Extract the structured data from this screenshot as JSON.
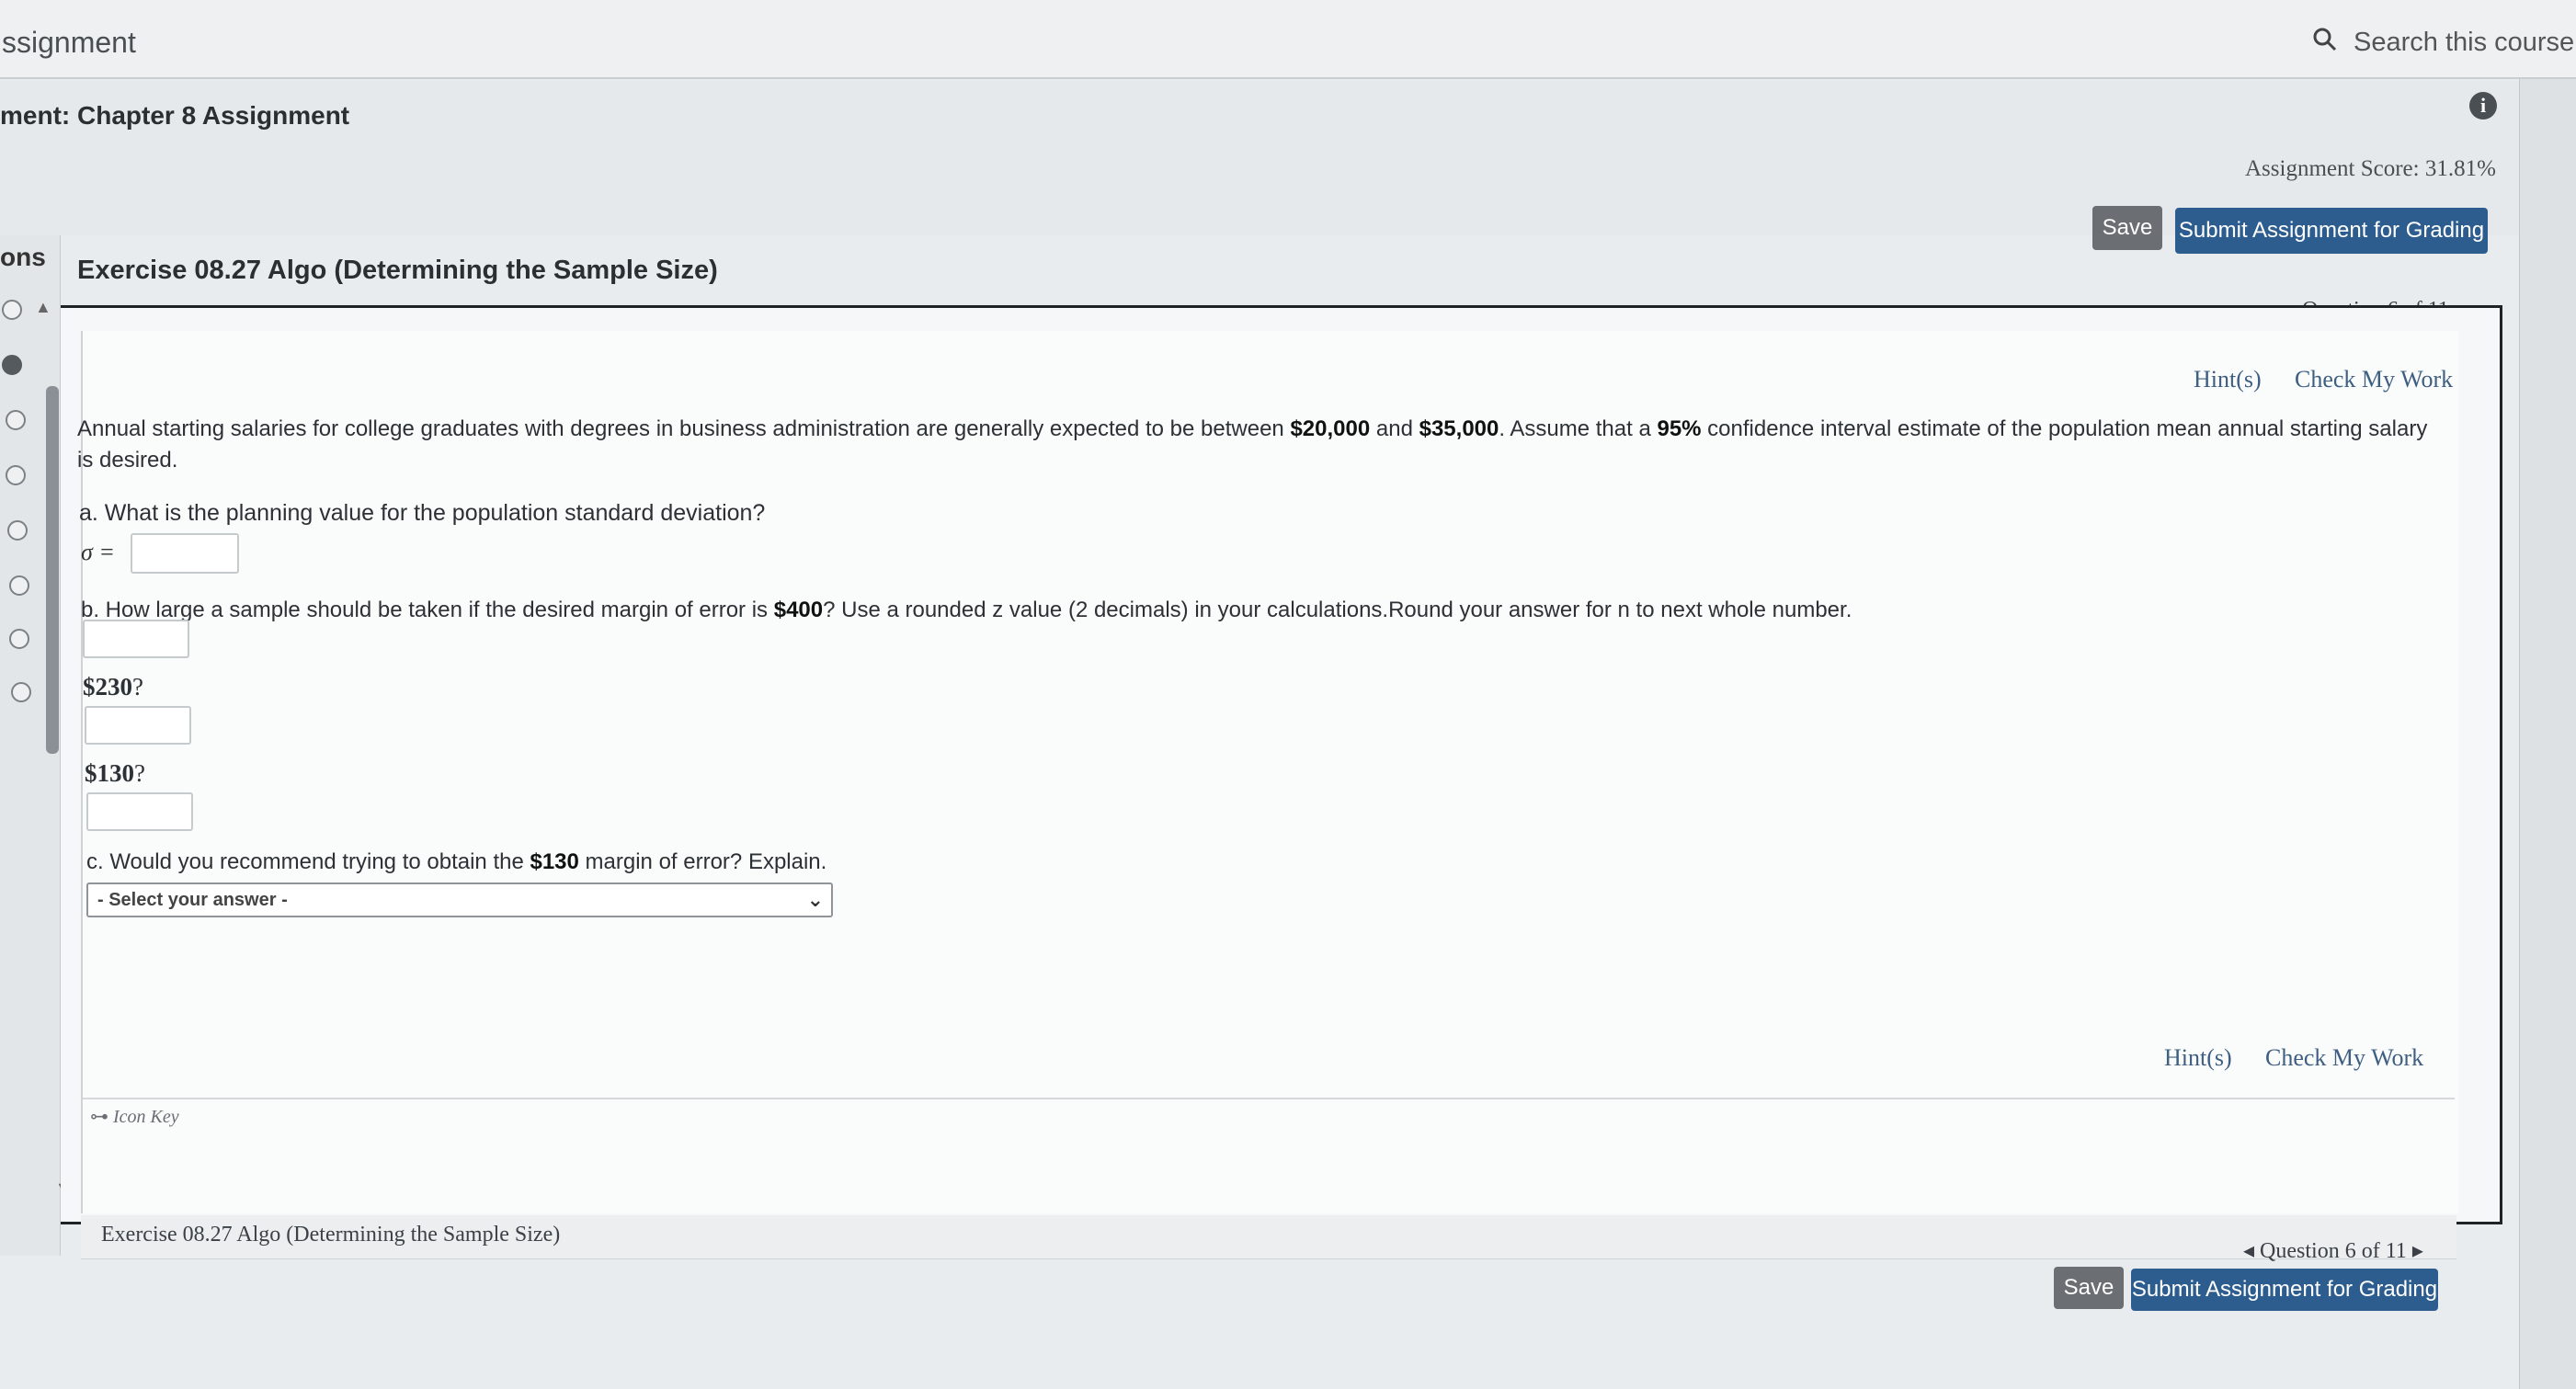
{
  "topbar": {
    "title": "ssignment",
    "search_placeholder": "Search this course"
  },
  "header": {
    "assignment_title": "ment: Chapter 8 Assignment",
    "score": "Assignment Score: 31.81%",
    "save_label": "Save",
    "submit_label": "Submit Assignment for Grading"
  },
  "left": {
    "label": "ons"
  },
  "exercise": {
    "title": "Exercise 08.27 Algo (Determining the Sample Size)",
    "question_nav": "Question 6 of 11",
    "hints": "Hint(s)",
    "check": "Check My Work",
    "intro_1": "Annual starting salaries for college graduates with degrees in business administration are generally expected to be between ",
    "amount_low": "$20,000",
    "and": " and ",
    "amount_high": "$35,000",
    "intro_2": ". Assume that a ",
    "confidence": "95%",
    "intro_3": " confidence interval estimate of the population mean annual starting salary is desired.",
    "qa": "a. What is the planning value for the population standard deviation?",
    "sigma_label": "σ =",
    "qb_1": "b. How large a sample should be taken if the desired margin of error is ",
    "qb_amount": "$400",
    "qb_2": "? Use a rounded z value (2 decimals) in your calculations.Round your answer for n to next whole number.",
    "label_230_amount": "$230",
    "label_230_q": "?",
    "label_130_amount": "$130",
    "label_130_q": "?",
    "qc_1": "c. Would you recommend trying to obtain the ",
    "qc_amount": "$130",
    "qc_2": " margin of error? Explain.",
    "select_value": "- Select your answer -",
    "icon_key": "Icon Key"
  },
  "footer": {
    "exercise_title": "Exercise 08.27 Algo (Determining the Sample Size)",
    "question_nav": "Question 6 of 11",
    "save_label": "Save",
    "submit_label": "Submit Assignment for Grading"
  },
  "icons": {
    "search": "search-icon",
    "info": "info-icon",
    "close": "close-icon",
    "chevron": "chevron-down-icon",
    "key": "key-icon"
  }
}
